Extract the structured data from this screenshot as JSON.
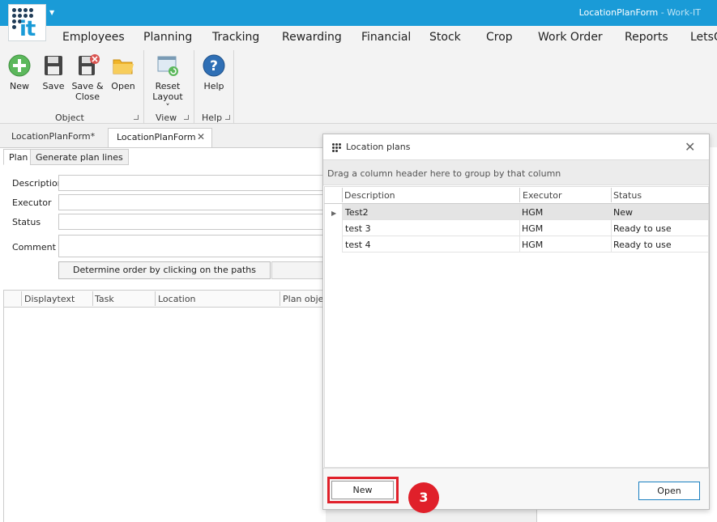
{
  "window": {
    "title": "LocationPlanForm",
    "app_name": "Work-IT",
    "separator": " - "
  },
  "menu": [
    "Employees",
    "Planning",
    "Tracking",
    "Rewarding",
    "Financial",
    "Stock",
    "Crop",
    "Work Order",
    "Reports",
    "LetsG"
  ],
  "ribbon": {
    "object_group": {
      "label": "Object",
      "buttons": [
        "New",
        "Save",
        "Save &",
        "Close",
        "Open"
      ]
    },
    "view_group": {
      "label": "View",
      "reset_line1": "Reset",
      "reset_line2": "Layout"
    },
    "help_group": {
      "label": "Help",
      "help_label": "Help"
    }
  },
  "doc_tabs": [
    "LocationPlanForm*",
    "LocationPlanForm"
  ],
  "form": {
    "subtabs": [
      "Plan",
      "Generate plan lines"
    ],
    "labels": {
      "description": "Description",
      "executor": "Executor",
      "status": "Status",
      "comment": "Comment"
    },
    "determine_button": "Determine order by clicking on the paths",
    "grid_columns": [
      "Displaytext",
      "Task",
      "Location",
      "Plan objec"
    ]
  },
  "dialog": {
    "title": "Location plans",
    "group_hint": "Drag a column header here to group by that column",
    "columns": [
      "Description",
      "Executor",
      "Status"
    ],
    "rows": [
      {
        "description": "Test2",
        "executor": "HGM",
        "status": "New"
      },
      {
        "description": "test 3",
        "executor": "HGM",
        "status": "Ready to use"
      },
      {
        "description": "test 4",
        "executor": "HGM",
        "status": "Ready to use"
      }
    ],
    "new_button": "New",
    "open_button": "Open"
  },
  "annotation": {
    "step": "3"
  },
  "colors": {
    "accent": "#1a9bd7",
    "highlight": "#e0202a",
    "logo_dark": "#1f3b57"
  }
}
